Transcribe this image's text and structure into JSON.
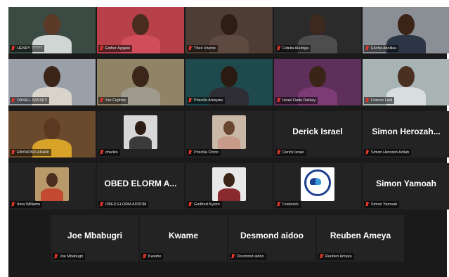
{
  "rows": [
    {
      "tiles": [
        {
          "caption": "HENRY ?????",
          "kind": "video",
          "bg": "#3b4a42",
          "face": "#5a3a26",
          "shirt": "#cfd6d4"
        },
        {
          "caption": "Esther Ayayee",
          "kind": "video",
          "bg": "#b8404a",
          "face": "#4a2c1e",
          "shirt": "#d04d5a",
          "active": true
        },
        {
          "caption": "Theo Vivene",
          "kind": "video",
          "bg": "#4d3d34",
          "face": "#2e1d14",
          "shirt": "#5e4a40"
        },
        {
          "caption": "Fidelia Akubiga",
          "kind": "video",
          "bg": "#2b2b2b",
          "face": "#3c2a20",
          "shirt": "#4d4d4d"
        },
        {
          "caption": "Ekoha Abolikia",
          "kind": "video",
          "bg": "#8a8f96",
          "face": "#3a2418",
          "shirt": "#2c3546"
        }
      ]
    },
    {
      "tiles": [
        {
          "caption": "DANIEL SASSEY",
          "kind": "video",
          "bg": "#9aa0a8",
          "face": "#3d2418",
          "shirt": "#d8d3cb"
        },
        {
          "caption": "Sre Cephas",
          "kind": "video",
          "bg": "#8f8466",
          "face": "#3b2619",
          "shirt": "#9e9a8e"
        },
        {
          "caption": "Priscilla Ameyaw",
          "kind": "video",
          "bg": "#1f4a4d",
          "face": "#2a1a12",
          "shirt": "#2e2e34"
        },
        {
          "caption": "Israel Dade Darkey",
          "kind": "video",
          "bg": "#5d2f5a",
          "face": "#3a2418",
          "shirt": "#7c3b74"
        },
        {
          "caption": "Francis Fedi",
          "kind": "video",
          "bg": "#a8b4b4",
          "face": "#4a3020",
          "shirt": "#d8dde0"
        }
      ]
    },
    {
      "tiles": [
        {
          "caption": "RAYMOND ANANI",
          "kind": "video",
          "bg": "#6a4a2c",
          "face": "#5c3820",
          "shirt": "#d9a32a"
        },
        {
          "caption": "charles",
          "kind": "photo",
          "bg": "#d8d8d8",
          "face": "#2d1c14",
          "shirt": "#3b3b3b"
        },
        {
          "caption": "Priscilla Ocloo",
          "kind": "photo",
          "bg": "#c9b8a6",
          "face": "#6a4530",
          "shirt": "#c79a8a"
        },
        {
          "caption": "Derick Israel",
          "kind": "name",
          "display_name": "Derick Israel"
        },
        {
          "caption": "Simon Herozah Azilah",
          "kind": "name",
          "display_name": "Simon Herozah..."
        }
      ]
    },
    {
      "tiles": [
        {
          "caption": "Ama Williams",
          "kind": "photo",
          "bg": "#b89a6a",
          "face": "#4a2e1e",
          "shirt": "#c34a2e"
        },
        {
          "caption": "OBED ELORM ADDOM",
          "kind": "name",
          "display_name": "OBED ELORM A..."
        },
        {
          "caption": "Godfred Kyeire",
          "kind": "photo",
          "bg": "#e8e8e8",
          "face": "#3a2418",
          "shirt": "#8a2a2e"
        },
        {
          "caption": "Frederick",
          "kind": "logo",
          "bg": "#ffffff"
        },
        {
          "caption": "Simon Yamoah",
          "kind": "name",
          "display_name": "Simon Yamoah"
        }
      ]
    },
    {
      "tiles": [
        {
          "caption": "Joe Mbabugri",
          "kind": "name",
          "display_name": "Joe Mbabugri"
        },
        {
          "caption": "Kwame",
          "kind": "name",
          "display_name": "Kwame"
        },
        {
          "caption": "Desmond aidoo",
          "kind": "name",
          "display_name": "Desmond aidoo"
        },
        {
          "caption": "Reuben Ameya",
          "kind": "name",
          "display_name": "Reuben Ameya"
        }
      ]
    }
  ],
  "colors": {
    "background": "#1a1a1a",
    "tile": "#232323",
    "active_border": "#b9d94a",
    "muted_mic": "#e0362c"
  },
  "icons": {
    "muted": "mic-muted-icon"
  }
}
